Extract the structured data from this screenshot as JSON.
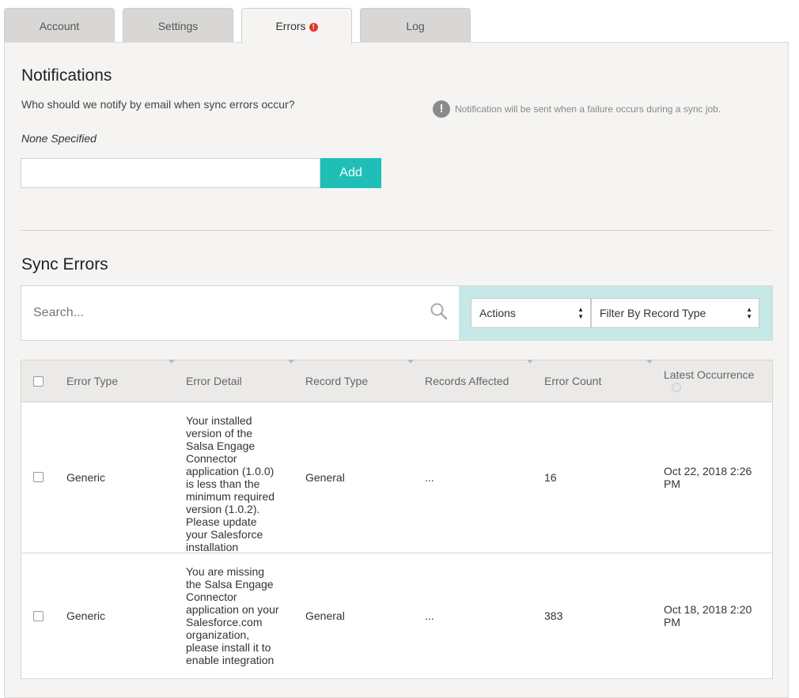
{
  "tabs": [
    {
      "label": "Account"
    },
    {
      "label": "Settings"
    },
    {
      "label": "Errors",
      "badge": "!"
    },
    {
      "label": "Log"
    }
  ],
  "notifications": {
    "title": "Notifications",
    "question": "Who should we notify by email when sync errors occur?",
    "current": "None Specified",
    "email_value": "",
    "add_label": "Add",
    "hint": "Notification will be sent when a failure occurs during a sync job."
  },
  "sync_errors": {
    "title": "Sync Errors",
    "search_placeholder": "Search...",
    "actions_label": "Actions",
    "filter_label": "Filter By Record Type",
    "columns": [
      "Error Type",
      "Error Detail",
      "Record Type",
      "Records Affected",
      "Error Count",
      "Latest Occurrence"
    ],
    "rows": [
      {
        "error_type": "Generic",
        "error_detail": "Your installed version of the Salsa Engage Connector application (1.0.0) is less than the minimum required version (1.0.2). Please update your Salesforce installation",
        "record_type": "General",
        "records_affected": "...",
        "error_count": "16",
        "latest": "Oct 22, 2018 2:26 PM"
      },
      {
        "error_type": "Generic",
        "error_detail": "You are missing the Salsa Engage Connector application on your Salesforce.com organization, please install it to enable integration",
        "record_type": "General",
        "records_affected": "...",
        "error_count": "383",
        "latest": "Oct 18, 2018 2:20 PM"
      }
    ]
  },
  "colors": {
    "accent": "#1fbfb8",
    "filter_bg": "#c6e8e7",
    "error_badge": "#e0362c"
  }
}
